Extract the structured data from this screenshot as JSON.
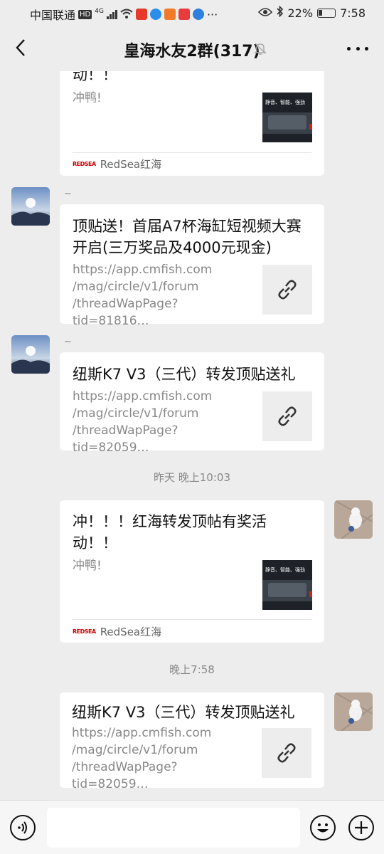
{
  "status": {
    "carrier": "中国联通",
    "hd": "HD",
    "network": "4G",
    "battery": "22%",
    "time": "7:58"
  },
  "header": {
    "title": "皇海水友2群(317)"
  },
  "messages": {
    "m1": {
      "title_tail": "动！！",
      "desc": "冲鸭!",
      "source": "RedSea红海",
      "logo_text": "REDSEA",
      "thumb_caption": "静音、智能、强劲"
    },
    "m2": {
      "nick": "~",
      "title": "顶贴送！首届A7杯海缸短视频大赛开启(三万奖品及4000元现金)",
      "url": "https://app.cmfish.com\n/mag/circle/v1/forum\n/threadWapPage?tid=81816…"
    },
    "m3": {
      "nick": "~",
      "title": "纽斯K7 V3（三代）转发顶贴送礼",
      "url": "https://app.cmfish.com\n/mag/circle/v1/forum\n/threadWapPage?tid=82059…"
    },
    "ts1": "昨天 晚上10:03",
    "m4": {
      "title": "冲！！！红海转发顶帖有奖活动！！",
      "desc": "冲鸭!",
      "source": "RedSea红海",
      "logo_text": "REDSEA",
      "thumb_caption": "静音、智能、强劲"
    },
    "ts2": "晚上7:58",
    "m5": {
      "title": "纽斯K7 V3（三代）转发顶贴送礼",
      "url": "https://app.cmfish.com\n/mag/circle/v1/forum\n/threadWapPage?tid=82059…"
    }
  },
  "input": {
    "placeholder": ""
  }
}
